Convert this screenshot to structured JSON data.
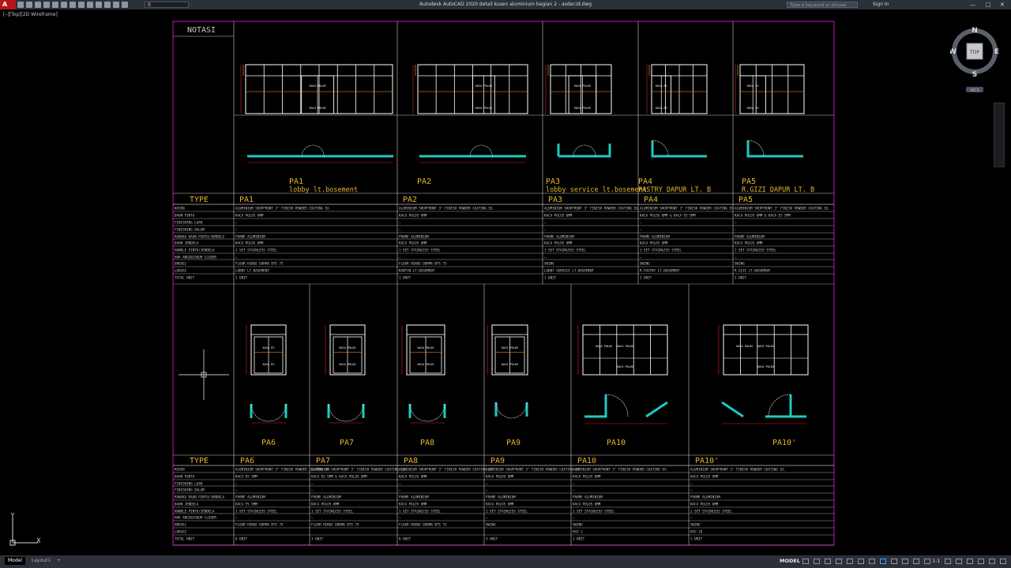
{
  "window": {
    "app_letter": "A",
    "title": "Autodesk AutoCAD 2020   detail kusen aluminium bagian 2 - asder.id.dwg",
    "search_placeholder": "Type a keyword or phrase",
    "signin_label": "Sign In",
    "layer_value": "0",
    "minimize": "—",
    "maximize": "□",
    "close": "✕"
  },
  "viewport_label": "[–][Top][2D Wireframe]",
  "viewcube": {
    "top_label": "TOP",
    "n": "N",
    "s": "S",
    "e": "E",
    "w": "W",
    "wcs_label": "WCS"
  },
  "ucs": {
    "x": "X",
    "y": "Y"
  },
  "notasi_label": "NOTASI",
  "row_labels_top": [
    "KUSEN",
    "DAUN PINTU",
    "FINISHING LUAR",
    "FINISHING DALAM",
    "RANGKA DAUN PINTU/JENDELA",
    "DAUN JENDELA",
    "HANDLE PINTU/JENDELA",
    "HAK ANGIN/DOOR CLOSER",
    "ENGSEL",
    "LOKASI",
    "TOTAL UNIT"
  ],
  "type_label": "TYPE",
  "top_types": [
    {
      "code": "PA1",
      "sub": "lobby  lt.bosement",
      "rows": [
        "ALUMINIUM SHOPFRONT 3\" FINISH POWDER COATING EX.",
        "KACA POLOS 6MM",
        "–",
        "–",
        "FRAME ALUMINIUM",
        "KACA POLOS 6MM",
        "1 SET STAINLESS STEEL",
        "–",
        "FLOOR HINGE DORMA BTS 75",
        "LOBBY LT.BASEMENT",
        "1 UNIT"
      ]
    },
    {
      "code": "PA2",
      "sub": "",
      "rows": [
        "ALUMINIUM SHOPFRONT 3\" FINISH POWDER COATING EX.",
        "KACA POLOS 6MM",
        "–",
        "–",
        "FRAME ALUMINIUM",
        "KACA POLOS 6MM",
        "1 SET STAINLESS STEEL",
        "–",
        "FLOOR HINGE DORMA BTS 75",
        "KANTIN LT.BASEMENT",
        "1 UNIT"
      ]
    },
    {
      "code": "PA3",
      "sub": "lobby  service  lt.bosement",
      "rows": [
        "ALUMINIUM SHOPFRONT 3\" FINISH POWDER COATING EX.",
        "KACA POLOS 6MM",
        "–",
        "–",
        "FRAME ALUMINIUM",
        "KACA POLOS 6MM",
        "1 SET STAINLESS STEEL",
        "–",
        "SWING",
        "LOBBY SERVICE LT.BASEMENT",
        "1 UNIT"
      ]
    },
    {
      "code": "PA4",
      "sub": "PASTRY  DAPUR  LT.  B",
      "rows": [
        "ALUMINIUM SHOPFRONT 3\" FINISH POWDER COATING EX.",
        "KACA POLOS 6MM & KACA ES 5MM",
        "–",
        "–",
        "FRAME ALUMINIUM",
        "KACA POLOS 6MM",
        "1 SET STAINLESS STEEL",
        "–",
        "SWING",
        "R.PASTRY LT.BASEMENT",
        "1 UNIT"
      ]
    },
    {
      "code": "PA5",
      "sub": "R.GIZI  DAPUR  LT.  B",
      "rows": [
        "ALUMINIUM SHOPFRONT 3\" FINISH POWDER COATING EX.",
        "KACA POLOS 6MM & KACA ES 5MM",
        "–",
        "–",
        "FRAME ALUMINIUM",
        "KACA POLOS 6MM",
        "1 SET STAINLESS STEEL",
        "–",
        "SWING",
        "R.GIZI LT.BASEMENT",
        "1 UNIT"
      ]
    }
  ],
  "bottom_types": [
    {
      "code": "PA6",
      "rows": [
        "ALUMINIUM SHOPFRONT 3\" FINISH POWDER COATING EX.",
        "KACA ES 5MM",
        "–",
        "–",
        "FRAME ALUMINIUM",
        "KACA ES 5MM",
        "1 SET STAINLESS STEEL",
        "–",
        "FLOOR HINGE DORMA BTS 75",
        "",
        "6 UNIT"
      ]
    },
    {
      "code": "PA7",
      "rows": [
        "ALUMINIUM SHOPFRONT 3\" FINISH POWDER COATING EX.",
        "KACA ES 5MM & KACA POLOS 6MM",
        "–",
        "–",
        "FRAME ALUMINIUM",
        "KACA POLOS 6MM",
        "1 SET STAINLESS STEEL",
        "–",
        "FLOOR HINGE DORMA BTS 75",
        "",
        "3 UNIT"
      ]
    },
    {
      "code": "PA8",
      "rows": [
        "ALUMINIUM SHOPFRONT 3\" FINISH POWDER COATING EX.",
        "KACA POLOS 6MM",
        "–",
        "–",
        "FRAME ALUMINIUM",
        "KACA POLOS 6MM",
        "1 SET STAINLESS STEEL",
        "–",
        "FLOOR HINGE DORMA BTS 75",
        "",
        "6 UNIT"
      ]
    },
    {
      "code": "PA9",
      "rows": [
        "ALUMINIUM SHOPFRONT 3\" FINISH POWDER COATING EX.",
        "KACA POLOS 6MM",
        "–",
        "–",
        "FRAME ALUMINIUM",
        "KACA POLOS 6MM",
        "1 SET STAINLESS STEEL",
        "–",
        "SWING",
        "",
        "3 UNIT"
      ]
    },
    {
      "code": "PA10",
      "rows": [
        "ALUMINIUM SHOPFRONT 3\" FINISH POWDER COATING EX.",
        "KACA POLOS 6MM",
        "–",
        "–",
        "FRAME ALUMINIUM",
        "KACA POLOS 6MM",
        "1 SET STAINLESS STEEL",
        "–",
        "SWING",
        "HCU 1",
        "1 UNIT"
      ]
    },
    {
      "code": "PA10'",
      "rows": [
        "ALUMINIUM SHOPFRONT 3\" FINISH POWDER COATING EX.",
        "KACA POLOS 6MM",
        "–",
        "–",
        "FRAME ALUMINIUM",
        "KACA POLOS 6MM",
        "1 SET STAINLESS STEEL",
        "–",
        "SWING",
        "HCU 10",
        "1 UNIT"
      ]
    }
  ],
  "elev_labels": {
    "kaca_polos": "KACA POLOS",
    "kaca_es": "KACA ES"
  },
  "status": {
    "tab_model": "Model",
    "tab_layout": "Layout1",
    "tab_add": "+",
    "model_label": "MODEL",
    "scale": "1:1"
  },
  "colors": {
    "frame": "#ffffff",
    "label": "#e8b630",
    "red": "#e02020",
    "cyan": "#20c8c0",
    "border": "#c010c0",
    "table": "#c8c8c8",
    "dim": "#e02020"
  }
}
